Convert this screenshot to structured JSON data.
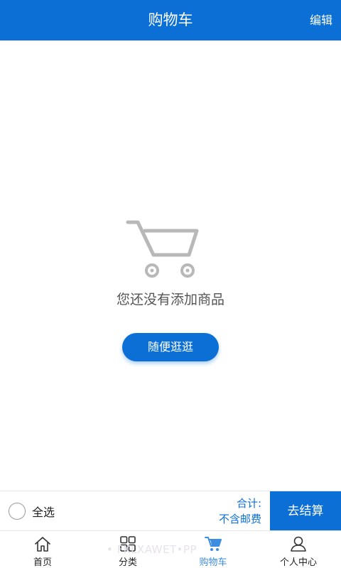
{
  "header": {
    "title": "购物车",
    "edit_label": "编辑"
  },
  "empty_state": {
    "message": "您还没有添加商品",
    "browse_label": "随便逛逛"
  },
  "checkout_bar": {
    "select_all_label": "全选",
    "total_label": "合计:",
    "shipping_note": "不含邮费",
    "checkout_label": "去结算"
  },
  "tabbar": {
    "items": [
      {
        "label": "首页",
        "icon": "home-icon",
        "active": false
      },
      {
        "label": "分类",
        "icon": "grid-icon",
        "active": false
      },
      {
        "label": "购物车",
        "icon": "cart-icon",
        "active": true
      },
      {
        "label": "个人中心",
        "icon": "person-icon",
        "active": false
      }
    ]
  },
  "watermark": "• FKLXAWET•PP",
  "colors": {
    "primary": "#0b6fd6",
    "active_tab": "#3d8de0",
    "illustration": "#b8b8b8"
  }
}
